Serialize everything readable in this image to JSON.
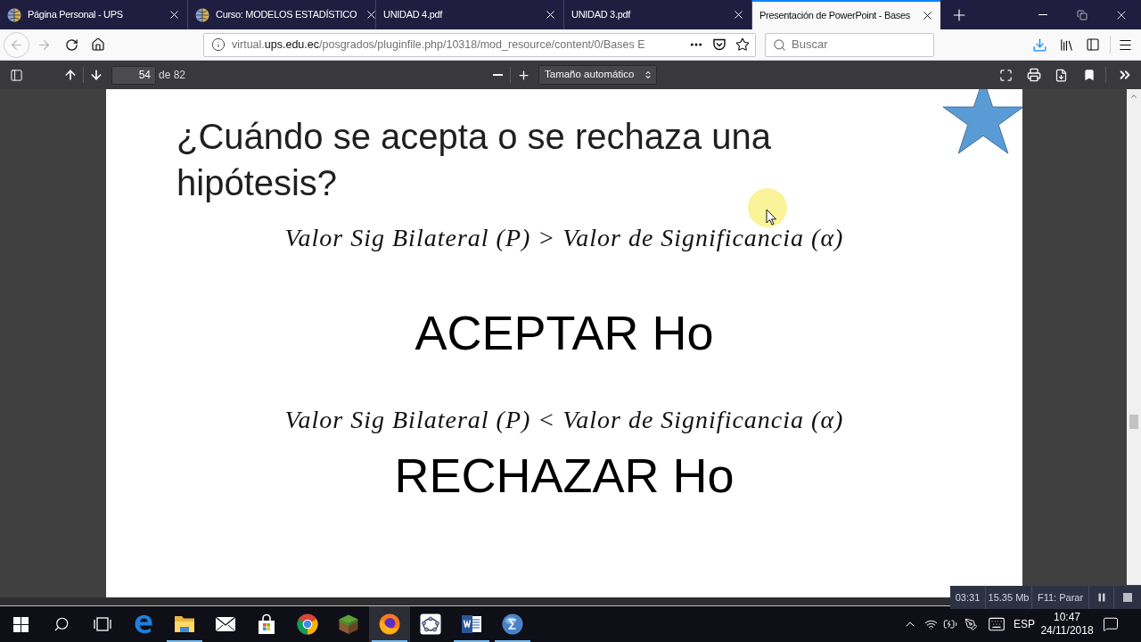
{
  "browser_tabs": [
    {
      "title": "Página Personal - UPS",
      "kind": "web",
      "selected": false
    },
    {
      "title": "Curso: MODELOS ESTADÍSTICO",
      "kind": "web",
      "selected": false
    },
    {
      "title": "UNIDAD 4.pdf",
      "kind": "document",
      "selected": false
    },
    {
      "title": "UNIDAD 3.pdf",
      "kind": "document",
      "selected": false
    },
    {
      "title": "Presentación de PowerPoint - Bases",
      "kind": "document",
      "selected": true
    }
  ],
  "navigation": {
    "back_disabled": true,
    "forward_disabled": true
  },
  "address_bar": {
    "url_prefix": "virtual.",
    "url_domain": "ups.edu.ec",
    "url_path": "/posgrados/pluginfile.php/10318/mod_resource/content/0/Bases E"
  },
  "search": {
    "placeholder": "Buscar"
  },
  "pdf_toolbar": {
    "page": "54",
    "page_count": "de 82",
    "zoom": "Tamaño automático"
  },
  "slide": {
    "title": "¿Cuándo se acepta o se rechaza una hipótesis?",
    "rules": [
      {
        "condition": "Valor Sig Bilateral (P) > Valor de Significancia (α)",
        "decision": "ACEPTAR Ho"
      },
      {
        "condition": "Valor Sig Bilateral (P) < Valor de Significancia (α)",
        "decision": "RECHAZAR Ho"
      }
    ]
  },
  "recorder": {
    "elapsed": "03:31",
    "size": "15.35 Mb",
    "stop_hint": "F11: Parar"
  },
  "taskbar": {
    "apps": [
      {
        "kind": "edge",
        "running": false,
        "selected": false
      },
      {
        "kind": "files",
        "running": true,
        "selected": false
      },
      {
        "kind": "mail",
        "running": false,
        "selected": false
      },
      {
        "kind": "store",
        "running": false,
        "selected": false
      },
      {
        "kind": "chrome",
        "running": false,
        "selected": false
      },
      {
        "kind": "blocks",
        "running": false,
        "selected": false
      },
      {
        "kind": "firefox",
        "running": true,
        "selected": true
      },
      {
        "kind": "graph",
        "running": false,
        "selected": false
      },
      {
        "kind": "word",
        "running": true,
        "selected": false
      },
      {
        "kind": "sigma",
        "running": true,
        "selected": false
      }
    ],
    "language": "ESP",
    "time": "10:47",
    "date": "24/11/2018"
  }
}
